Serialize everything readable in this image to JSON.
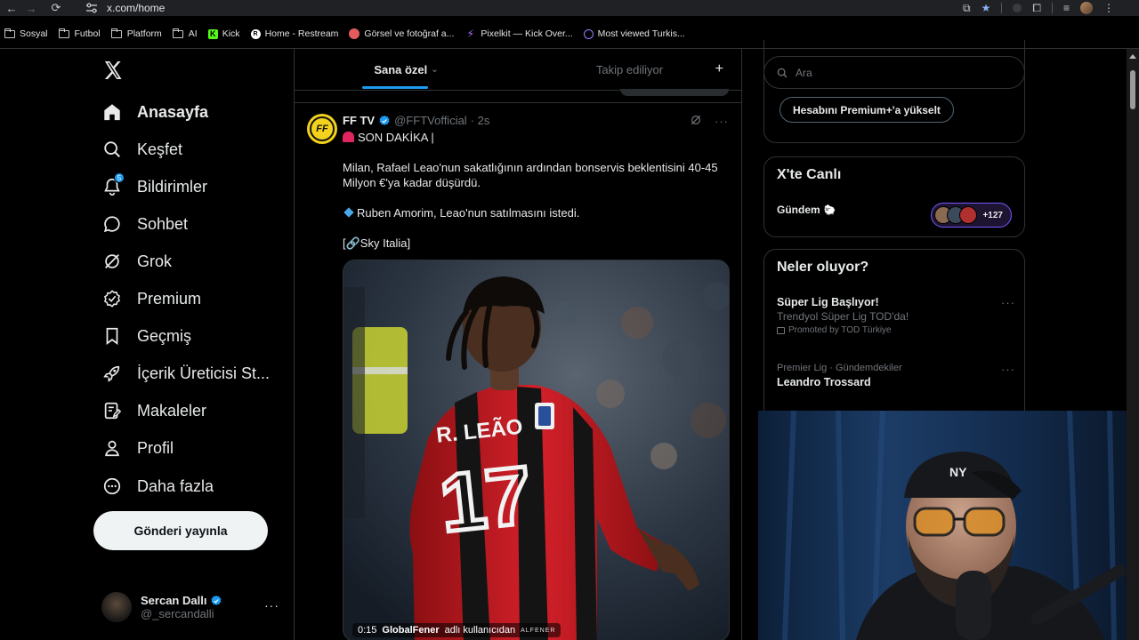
{
  "browser": {
    "url": "x.com/home",
    "bookmarks": [
      {
        "label": "Sosyal",
        "icon": "folder-icon"
      },
      {
        "label": "Futbol",
        "icon": "folder-icon"
      },
      {
        "label": "Platform",
        "icon": "folder-icon"
      },
      {
        "label": "AI",
        "icon": "folder-icon"
      },
      {
        "label": "Kick",
        "icon": "kick-icon"
      },
      {
        "label": "Home - Restream",
        "icon": "restream-icon"
      },
      {
        "label": "Görsel ve fotoğraf a...",
        "icon": "image-site-icon"
      },
      {
        "label": "Pixelkit — Kick Over...",
        "icon": "pixelkit-icon"
      },
      {
        "label": "Most viewed Turkis...",
        "icon": "twitch-tracker-icon"
      }
    ]
  },
  "sidebar": {
    "items": [
      {
        "label": "Anasayfa",
        "icon": "home-icon",
        "active": true
      },
      {
        "label": "Keşfet",
        "icon": "search-icon"
      },
      {
        "label": "Bildirimler",
        "icon": "bell-icon",
        "badge": "5"
      },
      {
        "label": "Sohbet",
        "icon": "chat-icon"
      },
      {
        "label": "Grok",
        "icon": "grok-icon"
      },
      {
        "label": "Premium",
        "icon": "premium-icon"
      },
      {
        "label": "Geçmiş",
        "icon": "bookmark-icon"
      },
      {
        "label": "İçerik Üreticisi St...",
        "icon": "rocket-icon"
      },
      {
        "label": "Makaleler",
        "icon": "article-icon"
      },
      {
        "label": "Profil",
        "icon": "profile-icon"
      },
      {
        "label": "Daha fazla",
        "icon": "more-circle-icon"
      }
    ],
    "post_button": "Gönderi yayınla",
    "account": {
      "name": "Sercan Dallı",
      "handle": "@_sercandalli",
      "more": "···"
    }
  },
  "main": {
    "tabs": [
      {
        "label": "Sana özel",
        "active": true
      },
      {
        "label": "Takip ediliyor",
        "active": false
      }
    ],
    "add_tab": "+",
    "tweet": {
      "name": "FF TV",
      "handle": "@FFTVofficial",
      "time": "· 2s",
      "avatar_text": "FF",
      "headline": "SON DAKİKA |",
      "paragraph1": "Milan, Rafael Leao'nun sakatlığının ardından bonservis beklentisini 40-45 Milyon €'ya kadar düşürdü.",
      "paragraph2": "Ruben Amorim, Leao'nun satılmasını istedi.",
      "source": "[🔗Sky Italia]",
      "video": {
        "time": "0:15",
        "credit_user": "GlobalFener",
        "credit_suffix": "adlı kullanıcıdan",
        "watermark": "ALFENER",
        "jersey_name": "R. LEÃO",
        "jersey_number": "17"
      }
    }
  },
  "right": {
    "search_placeholder": "Ara",
    "premium_button": "Hesabını Premium+'a yükselt",
    "live": {
      "title": "X'te Canlı",
      "topic": "Gündem",
      "count": "+127"
    },
    "trends": {
      "title": "Neler oluyor?",
      "items": [
        {
          "title": "Süper Lig Başlıyor!",
          "subtitle": "Trendyol Süper Lig TOD'da!",
          "promoted": "Promoted by TOD Türkiye"
        },
        {
          "meta": "Premier Lig · Gündemdekiler",
          "title": "Leandro Trossard"
        }
      ]
    }
  },
  "colors": {
    "accent": "#1d9bf0",
    "background": "#000000",
    "border": "#2f3336",
    "muted": "#71767b",
    "live_purple": "#7856ff"
  }
}
